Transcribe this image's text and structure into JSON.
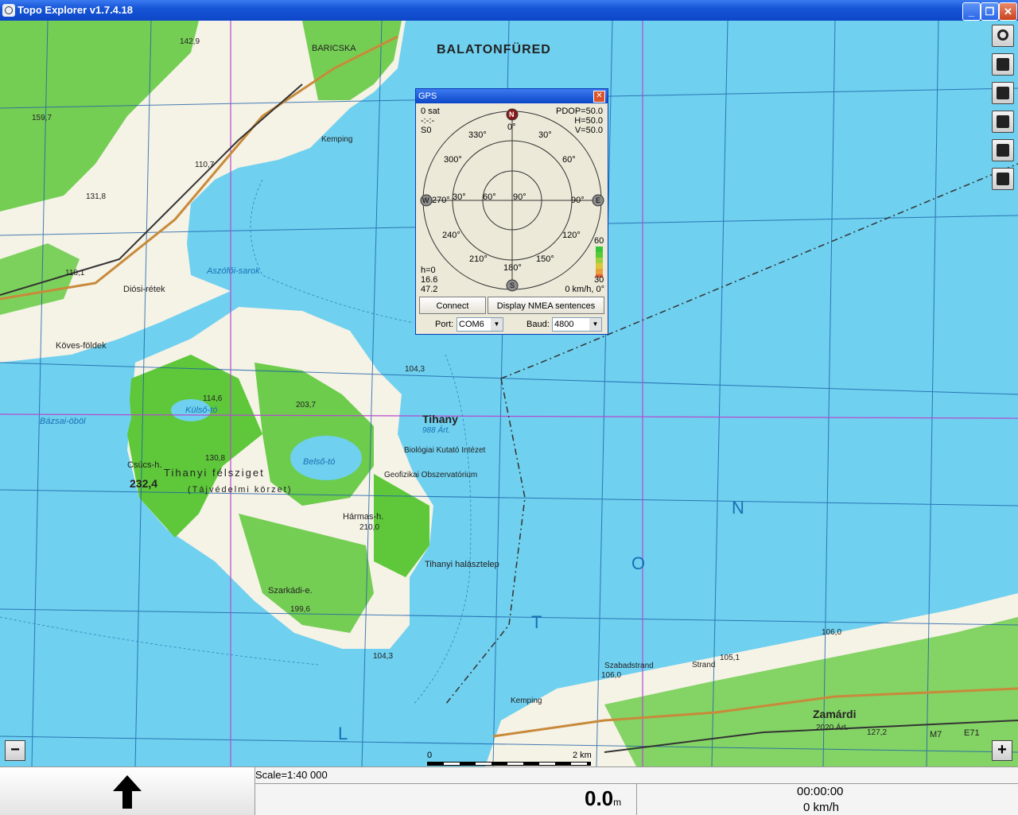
{
  "window": {
    "title": "Topo Explorer v1.7.4.18"
  },
  "map": {
    "labels": {
      "balatonfured": "BALATONFÜRED",
      "baricska": "BARICSKA",
      "tihany": "Tihany",
      "tihany_art": "988 Árt.",
      "zamardi": "Zamárdi",
      "zamardi_art": "2020 Árt.",
      "kovesfoldek": "Köves-földek",
      "diosiretek": "Diósi-rétek",
      "aszofoisarok": "Aszófői-sarok",
      "bazsaiobol": "Bázsai-öböl",
      "kulsoto": "Külső-tó",
      "belsoto": "Belső-tó",
      "tihanyi_felsziget": "Tihanyi félsziget",
      "tajvedelmi": "(Tájvédelmi körzet)",
      "csucs_h": "Csúcs-h.",
      "csucs_val": "232,4",
      "harmas_h": "Hármas-h.",
      "biologiai": "Biológiai Kutató Intézet",
      "obszervatorium": "Geofizikai Obszervatórium",
      "halasztelep": "Tihanyi halásztelep",
      "szarkadi": "Szarkádi-e.",
      "kemping1": "Kemping",
      "kemping2": "Kemping",
      "szabadstrand": "Szabadstrand",
      "strand": "Strand",
      "lake_n": "N",
      "lake_o": "O",
      "lake_t": "T",
      "lake_l": "L",
      "e71": "E71",
      "m7": "M7",
      "v1429": "142,9",
      "v1597": "159,7",
      "v1107": "110,7",
      "v1318": "131,8",
      "v1181": "118,1",
      "v1146": "114,6",
      "v2037": "203,7",
      "v1308": "130,8",
      "v2100": "210,0",
      "v1996": "199,6",
      "v1051": "105,1",
      "v1060": "106,0",
      "v1060b": "106,0",
      "v1272": "127,2",
      "v1043": "104,3",
      "v1043b": "104,3"
    }
  },
  "scale_bar": {
    "start": "0",
    "end": "2 km"
  },
  "gps": {
    "title": "GPS",
    "sat": "0 sat",
    "dashes": "-:-:-",
    "s0": "S0",
    "pdop": "PDOP=50.0",
    "h": "H=50.0",
    "v": "V=50.0",
    "n": "N",
    "e": "E",
    "s": "S",
    "w": "W",
    "deg0": "0°",
    "deg30": "30°",
    "deg60": "60°",
    "deg90": "90°",
    "deg120": "120°",
    "deg150": "150°",
    "deg180": "180°",
    "deg210": "210°",
    "deg240": "240°",
    "deg270": "270°",
    "deg300": "300°",
    "deg330": "330°",
    "ring30": "30°",
    "ring60": "60°",
    "ring90": "90°",
    "bar_top": "60",
    "bar_bot": "30",
    "h0": "h=0",
    "val1": "16.6",
    "val2": "47.2",
    "speed_heading": "0 km/h, 0°",
    "connect": "Connect",
    "display_nmea": "Display NMEA sentences",
    "port_label": "Port:",
    "port_value": "COM6",
    "baud_label": "Baud:",
    "baud_value": "4800"
  },
  "status": {
    "scale": "Scale=1:40 000",
    "distance": "0.0",
    "distance_unit": "m",
    "time": "00:00:00",
    "speed": "0 km/h"
  },
  "colors": {
    "water": "#6fd0ef",
    "forest": "#5ec83a",
    "land": "#f5f2e6",
    "grid": "#1b5fa8",
    "meridian": "#b44bd0"
  }
}
